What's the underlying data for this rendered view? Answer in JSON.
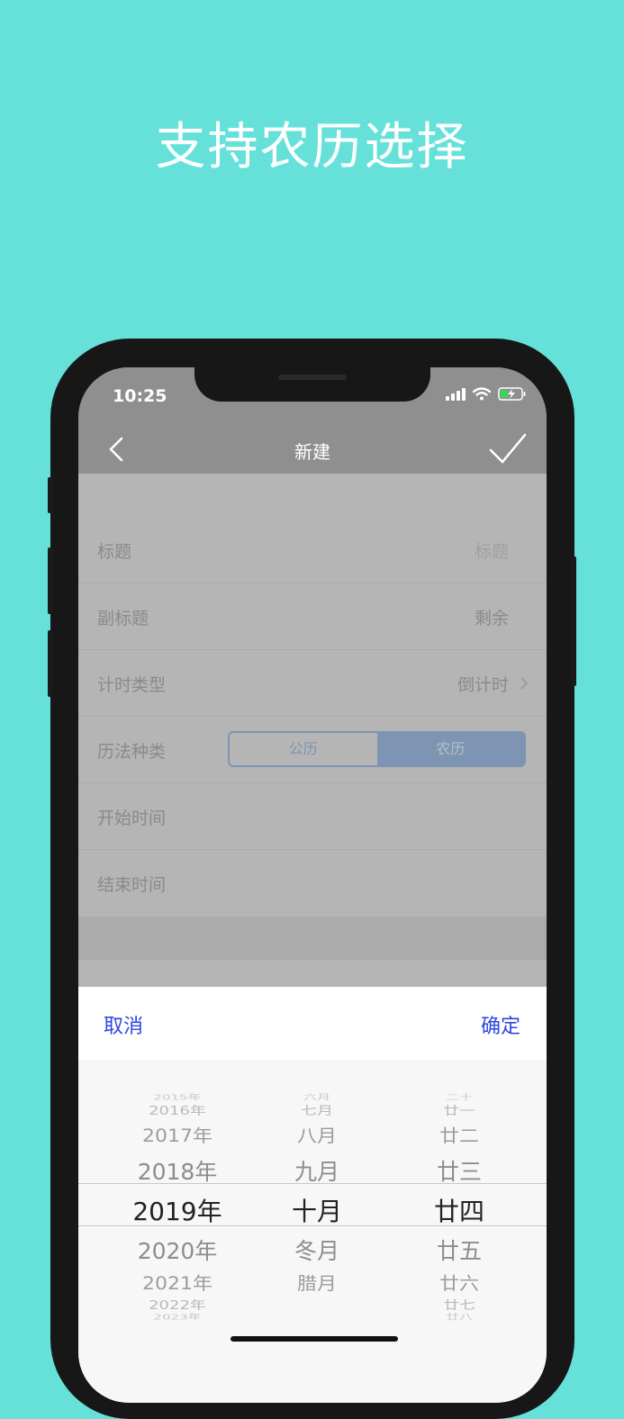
{
  "promo": {
    "title": "支持农历选择"
  },
  "status_bar": {
    "time": "10:25"
  },
  "nav": {
    "title": "新建"
  },
  "form": {
    "title_label": "标题",
    "title_placeholder": "标题",
    "subtitle_label": "副标题",
    "subtitle_value": "剩余",
    "timer_type_label": "计时类型",
    "timer_type_value": "倒计时",
    "calendar_label": "历法种类",
    "calendar_options": [
      "公历",
      "农历"
    ],
    "calendar_selected": "农历",
    "start_label": "开始时间",
    "end_label": "结束时间"
  },
  "picker": {
    "cancel": "取消",
    "confirm": "确定",
    "years": [
      "2015年",
      "2016年",
      "2017年",
      "2018年",
      "2019年",
      "2020年",
      "2021年",
      "2022年",
      "2023年"
    ],
    "months": [
      "六月",
      "七月",
      "八月",
      "九月",
      "十月",
      "冬月",
      "腊月"
    ],
    "days": [
      "二十",
      "廿一",
      "廿二",
      "廿三",
      "廿四",
      "廿五",
      "廿六",
      "廿七",
      "廿八"
    ],
    "selected": {
      "year": "2019年",
      "month": "十月",
      "day": "廿四"
    }
  },
  "colors": {
    "background": "#65E1DA",
    "accent_blue": "#2D46E0",
    "segment_blue": "#7D95B3",
    "nav_gray": "#8F8F8F"
  }
}
